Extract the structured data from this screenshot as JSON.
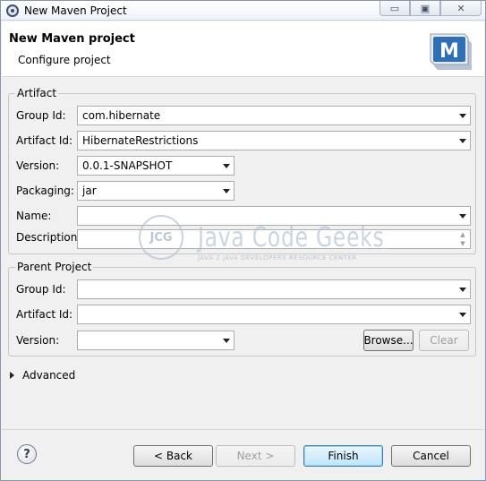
{
  "window": {
    "title": "New Maven Project",
    "controls": {
      "minimize": "▭",
      "maximize": "▣",
      "close": "✕"
    }
  },
  "header": {
    "title": "New Maven project",
    "subtitle": "Configure project",
    "logo_letter": "M"
  },
  "artifact": {
    "group_title": "Artifact",
    "group_id": {
      "label": "Group Id:",
      "value": "com.hibernate"
    },
    "artifact_id": {
      "label": "Artifact Id:",
      "value": "HibernateRestrictions"
    },
    "version": {
      "label": "Version:",
      "value": "0.0.1-SNAPSHOT"
    },
    "packaging": {
      "label": "Packaging:",
      "value": "jar"
    },
    "name": {
      "label": "Name:",
      "value": ""
    },
    "description": {
      "label": "Description:",
      "value": ""
    }
  },
  "parent": {
    "group_title": "Parent Project",
    "group_id": {
      "label": "Group Id:",
      "value": ""
    },
    "artifact_id": {
      "label": "Artifact Id:",
      "value": ""
    },
    "version": {
      "label": "Version:",
      "value": ""
    },
    "browse_label": "Browse...",
    "clear_label": "Clear"
  },
  "advanced": {
    "label": "Advanced"
  },
  "footer": {
    "help": "?",
    "back": "< Back",
    "next": "Next >",
    "finish": "Finish",
    "cancel": "Cancel"
  },
  "watermark": {
    "circle": "JCG",
    "name": "Java Code Geeks",
    "tagline": "JAVA 2 JAVA DEVELOPERS RESOURCE CENTER"
  },
  "colors": {
    "window_bg": "#f0f0f0",
    "header_bg": "#ffffff",
    "default_button_border": "#3c7fb1",
    "maven_logo": "#2f6fb6"
  }
}
